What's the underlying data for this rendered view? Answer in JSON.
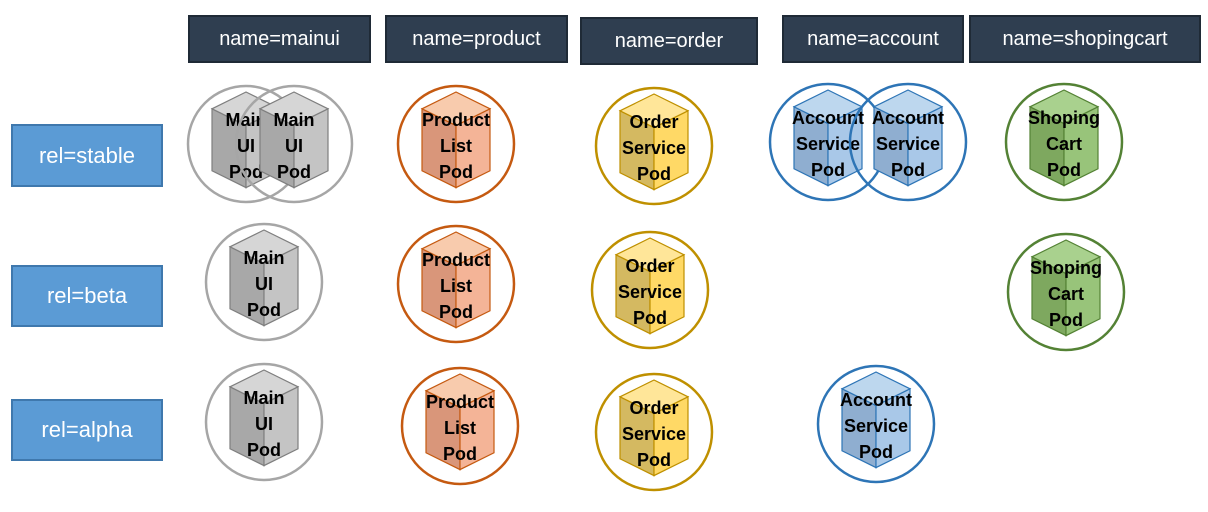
{
  "columns": [
    {
      "label": "name=mainui"
    },
    {
      "label": "name=product"
    },
    {
      "label": "name=order"
    },
    {
      "label": "name=account"
    },
    {
      "label": "name=shopingcart"
    }
  ],
  "rows": [
    {
      "label": "rel=stable"
    },
    {
      "label": "rel=beta"
    },
    {
      "label": "rel=alpha"
    }
  ],
  "pod_types": {
    "mainui": {
      "lines": [
        "Main",
        "UI",
        "Pod"
      ],
      "ring": "#a6a6a6",
      "fill": "#d6d6d6",
      "left": "#a8a8a8",
      "right": "#c4c4c4",
      "edge": "#7f7f7f"
    },
    "product": {
      "lines": [
        "Product",
        "List",
        "Pod"
      ],
      "ring": "#c55a11",
      "fill": "#f8cbad",
      "left": "#d9967a",
      "right": "#f4b497",
      "edge": "#c55a11"
    },
    "order": {
      "lines": [
        "Order",
        "Service",
        "Pod"
      ],
      "ring": "#bf9000",
      "fill": "#ffe699",
      "left": "#d4b961",
      "right": "#ffd966",
      "edge": "#bf9000"
    },
    "account": {
      "lines": [
        "Account",
        "Service",
        "Pod"
      ],
      "ring": "#2e75b6",
      "fill": "#bdd7ee",
      "left": "#8faed0",
      "right": "#a9c8e8",
      "edge": "#2e75b6"
    },
    "cart": {
      "lines": [
        "Shoping",
        "Cart",
        "Pod"
      ],
      "ring": "#548235",
      "fill": "#a9d18e",
      "left": "#7ea85f",
      "right": "#98c47a",
      "edge": "#548235"
    }
  },
  "pods": [
    {
      "type": "mainui",
      "column": 0,
      "row": 0
    },
    {
      "type": "mainui",
      "column": 0,
      "row": 0
    },
    {
      "type": "mainui",
      "column": 0,
      "row": 1
    },
    {
      "type": "mainui",
      "column": 0,
      "row": 2
    },
    {
      "type": "product",
      "column": 1,
      "row": 0
    },
    {
      "type": "product",
      "column": 1,
      "row": 1
    },
    {
      "type": "product",
      "column": 1,
      "row": 2
    },
    {
      "type": "order",
      "column": 2,
      "row": 0
    },
    {
      "type": "order",
      "column": 2,
      "row": 1
    },
    {
      "type": "order",
      "column": 2,
      "row": 2
    },
    {
      "type": "account",
      "column": 3,
      "row": 0
    },
    {
      "type": "account",
      "column": 3,
      "row": 0
    },
    {
      "type": "account",
      "column": 3,
      "row": 2
    },
    {
      "type": "cart",
      "column": 4,
      "row": 0
    },
    {
      "type": "cart",
      "column": 4,
      "row": 1
    }
  ]
}
